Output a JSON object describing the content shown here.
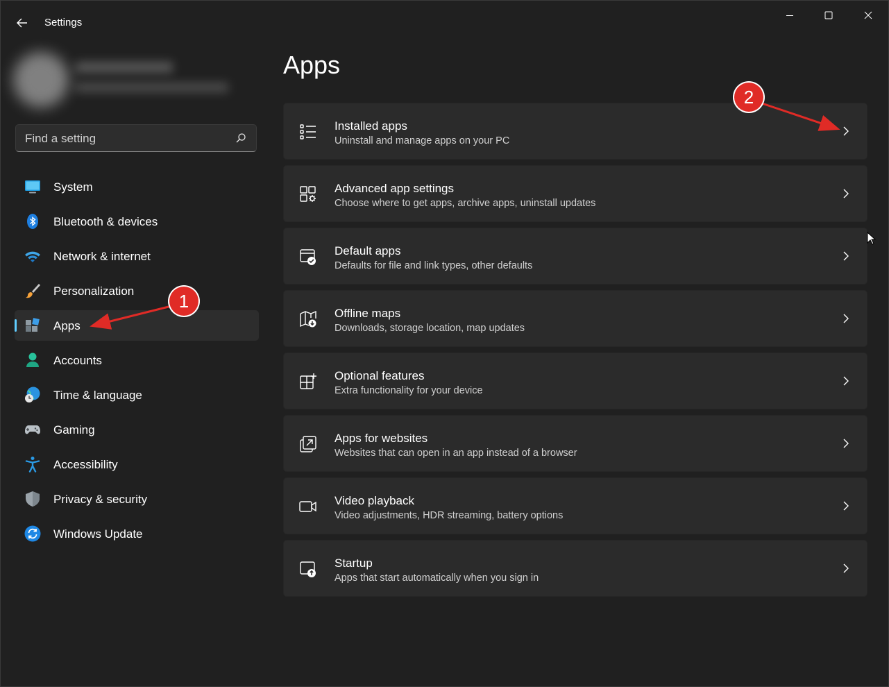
{
  "window": {
    "title": "Settings",
    "back_icon": "back-arrow-icon",
    "controls": [
      "minimize-icon",
      "maximize-icon",
      "close-icon"
    ]
  },
  "sidebar": {
    "search": {
      "placeholder": "Find a setting",
      "value": "",
      "icon": "search-icon"
    },
    "items": [
      {
        "label": "System",
        "icon": "system-icon",
        "selected": false
      },
      {
        "label": "Bluetooth & devices",
        "icon": "bluetooth-icon",
        "selected": false
      },
      {
        "label": "Network & internet",
        "icon": "wifi-icon",
        "selected": false
      },
      {
        "label": "Personalization",
        "icon": "brush-icon",
        "selected": false
      },
      {
        "label": "Apps",
        "icon": "apps-icon",
        "selected": true
      },
      {
        "label": "Accounts",
        "icon": "accounts-icon",
        "selected": false
      },
      {
        "label": "Time & language",
        "icon": "globe-clock-icon",
        "selected": false
      },
      {
        "label": "Gaming",
        "icon": "gamepad-icon",
        "selected": false
      },
      {
        "label": "Accessibility",
        "icon": "accessibility-icon",
        "selected": false
      },
      {
        "label": "Privacy & security",
        "icon": "shield-icon",
        "selected": false
      },
      {
        "label": "Windows Update",
        "icon": "update-icon",
        "selected": false
      }
    ]
  },
  "main": {
    "title": "Apps",
    "cards": [
      {
        "title": "Installed apps",
        "desc": "Uninstall and manage apps on your PC",
        "icon": "list-icon"
      },
      {
        "title": "Advanced app settings",
        "desc": "Choose where to get apps, archive apps, uninstall updates",
        "icon": "app-settings-icon"
      },
      {
        "title": "Default apps",
        "desc": "Defaults for file and link types, other defaults",
        "icon": "default-apps-icon"
      },
      {
        "title": "Offline maps",
        "desc": "Downloads, storage location, map updates",
        "icon": "map-icon"
      },
      {
        "title": "Optional features",
        "desc": "Extra functionality for your device",
        "icon": "add-feature-icon"
      },
      {
        "title": "Apps for websites",
        "desc": "Websites that can open in an app instead of a browser",
        "icon": "open-link-icon"
      },
      {
        "title": "Video playback",
        "desc": "Video adjustments, HDR streaming, battery options",
        "icon": "video-icon"
      },
      {
        "title": "Startup",
        "desc": "Apps that start automatically when you sign in",
        "icon": "startup-icon"
      }
    ]
  },
  "annotations": {
    "badge1": "1",
    "badge2": "2",
    "color": "#e02b26"
  },
  "colors": {
    "background": "#202020",
    "card": "#2b2b2b",
    "accent": "#60cdff"
  }
}
